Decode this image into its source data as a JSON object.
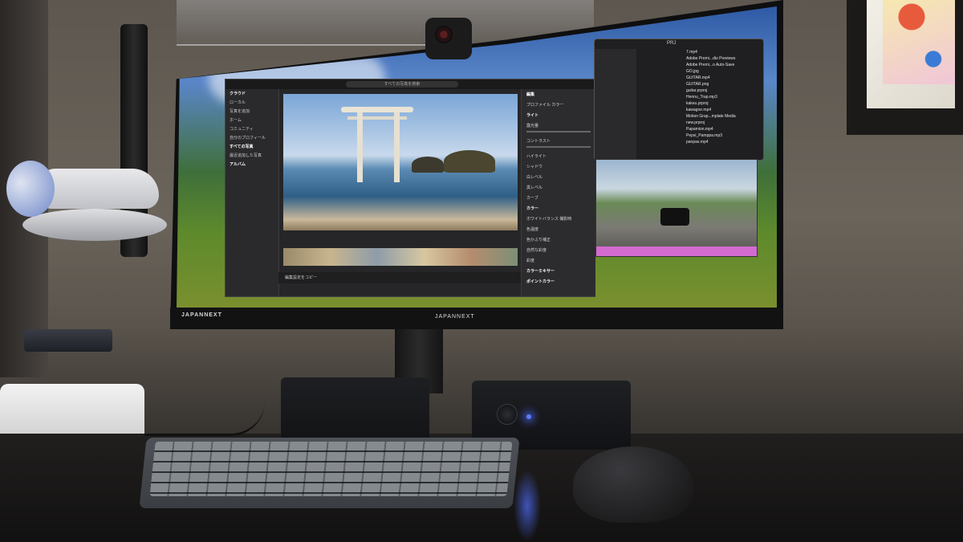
{
  "monitor": {
    "brand_chin": "JAPANNEXT",
    "brand_left": "JAPANNEXT"
  },
  "lightroom": {
    "search_placeholder": "すべての写真を検索",
    "sidebar_items": [
      "クラウド",
      "ローカル",
      "写真を追加",
      "ホーム",
      "コミュニティ",
      "自分のプロフィール",
      "すべての写真",
      "最近追加した写真",
      "アルバム"
    ],
    "panel_items": [
      "編集",
      "プロファイル カラー",
      "ライト",
      "露光量",
      "コントラスト",
      "ハイライト",
      "シャドウ",
      "白レベル",
      "黒レベル",
      "カーブ",
      "カラー",
      "ホワイトバランス 撮影時",
      "色温度",
      "色かぶり補正",
      "自然な彩度",
      "彩度",
      "カラーミキサー",
      "ポイントカラー"
    ],
    "bottom_bar": "編集設定をコピー"
  },
  "finder": {
    "title": "PRJ",
    "files": [
      "7.mp4",
      "Adobe Premi...dio Previews",
      "Adobe Premi...o Auto-Save",
      "GO.jpg",
      "GUITAR.mp4",
      "GUITAR.png",
      "guitar.prproj",
      "Hennu_Trap.mp3",
      "kakeu.prproj",
      "kawagoe.mp4",
      "Motion Grap...mplate Media",
      "new.prproj",
      "Papamion.mp4",
      "Pepsi_Pamppa.mp3",
      "panpas.mp4"
    ]
  },
  "colors": {
    "led": "#5f7bff",
    "lr_bg": "#262628"
  }
}
